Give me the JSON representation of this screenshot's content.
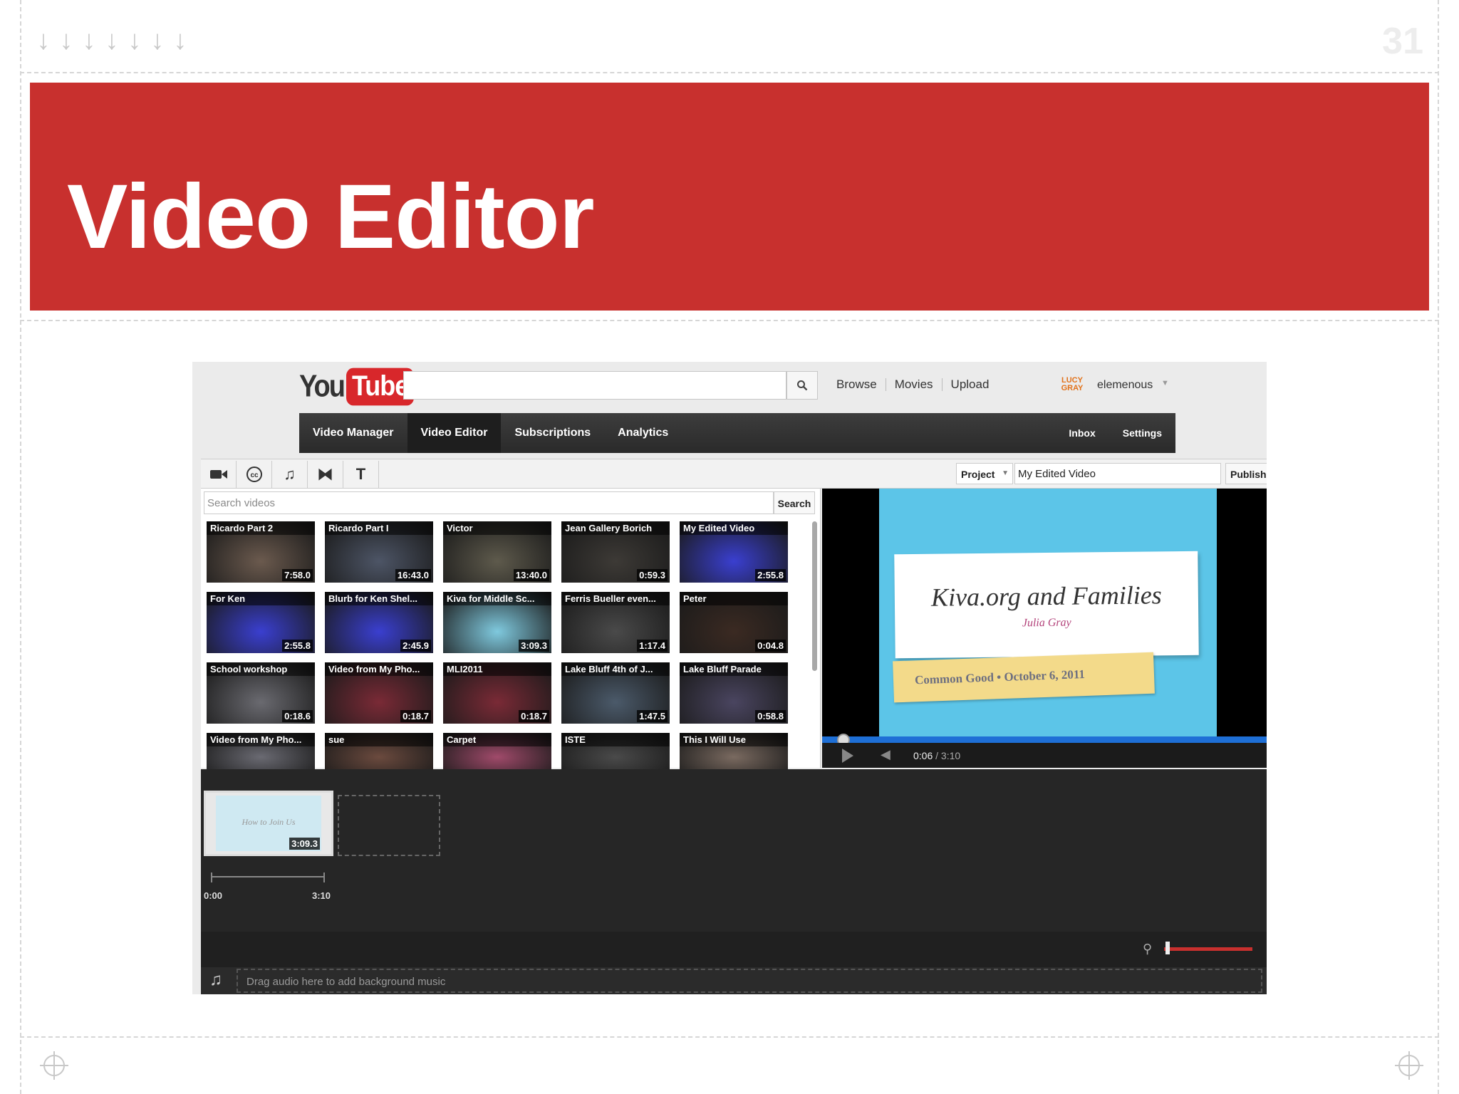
{
  "slide": {
    "number": "31",
    "title": "Video Editor",
    "accent_color": "#c8302e",
    "arrow_glyph": "↓",
    "arrow_count": 7
  },
  "youtube": {
    "logo_you": "You",
    "logo_tube": "Tube",
    "search_placeholder": "",
    "top_links": [
      "Browse",
      "Movies",
      "Upload"
    ],
    "avatar_text": "LUCY GRAY",
    "username": "elemenous"
  },
  "main_nav": {
    "items": [
      "Video Manager",
      "Video Editor",
      "Subscriptions",
      "Analytics"
    ],
    "active": "Video Editor",
    "right_items": [
      "Inbox",
      "Settings"
    ]
  },
  "toolbar": {
    "tools": [
      "video-camera-icon",
      "closed-caption-icon",
      "music-note-icon",
      "transition-icon",
      "text-icon"
    ],
    "project_label": "Project",
    "project_name": "My Edited Video",
    "publish_label": "Publish"
  },
  "library": {
    "search_placeholder": "Search videos",
    "search_button": "Search",
    "videos": [
      {
        "title": "Ricardo Part 2",
        "duration": "7:58.0",
        "tone": "#6b5a4e"
      },
      {
        "title": "Ricardo Part I",
        "duration": "16:43.0",
        "tone": "#4d5566"
      },
      {
        "title": "Victor",
        "duration": "13:40.0",
        "tone": "#5e5a4c"
      },
      {
        "title": "Jean Gallery Borich",
        "duration": "0:59.3",
        "tone": "#3d3a36"
      },
      {
        "title": "My Edited Video",
        "duration": "2:55.8",
        "tone": "#3a3fd0"
      },
      {
        "title": "For Ken",
        "duration": "2:55.8",
        "tone": "#3a3fd0"
      },
      {
        "title": "Blurb for Ken Shel...",
        "duration": "2:45.9",
        "tone": "#3a3fd0"
      },
      {
        "title": "Kiva for Middle Sc...",
        "duration": "3:09.3",
        "tone": "#7fc9de"
      },
      {
        "title": "Ferris Bueller even...",
        "duration": "1:17.4",
        "tone": "#4a4a4a"
      },
      {
        "title": "Peter",
        "duration": "0:04.8",
        "tone": "#3b2a22"
      },
      {
        "title": "School workshop",
        "duration": "0:18.6",
        "tone": "#6a6a70"
      },
      {
        "title": "Video from My Pho...",
        "duration": "0:18.7",
        "tone": "#7a2a36"
      },
      {
        "title": "MLI2011",
        "duration": "0:18.7",
        "tone": "#7a2a36"
      },
      {
        "title": "Lake Bluff 4th of J...",
        "duration": "1:47.5",
        "tone": "#4b5a6a"
      },
      {
        "title": "Lake Bluff Parade",
        "duration": "0:58.8",
        "tone": "#4a4560"
      },
      {
        "title": "Video from My Pho...",
        "duration": "",
        "tone": "#6a6a72"
      },
      {
        "title": "sue",
        "duration": "",
        "tone": "#6b4a3e"
      },
      {
        "title": "Carpet",
        "duration": "",
        "tone": "#a04a6a"
      },
      {
        "title": "ISTE",
        "duration": "",
        "tone": "#4a4a4a"
      },
      {
        "title": "This I Will Use",
        "duration": "",
        "tone": "#7a6a60"
      }
    ]
  },
  "player": {
    "card_title": "Kiva.org and Families",
    "card_subtitle": "Julia Gray",
    "note_text": "Common Good • October 6, 2011",
    "current_time": "0:06",
    "total_time": "/ 3:10",
    "progress": 0.03
  },
  "timeline": {
    "clip_title": "How to Join Us",
    "clip_duration": "3:09.3",
    "ruler_start": "0:00",
    "ruler_end": "3:10",
    "audio_hint": "Drag audio here to add background music"
  }
}
